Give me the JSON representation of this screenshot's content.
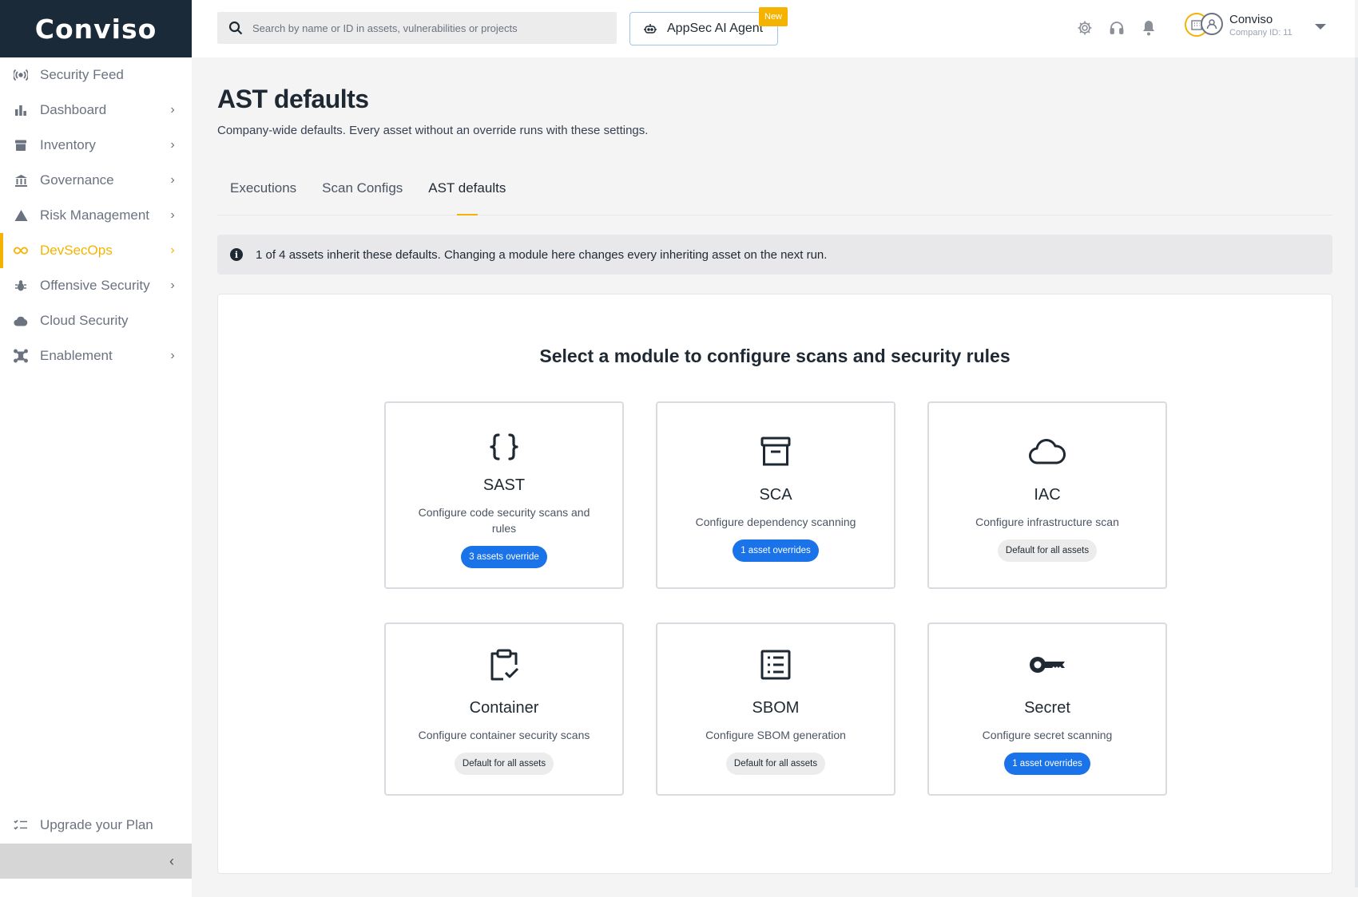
{
  "brand": {
    "logo_text": "Conviso",
    "accent": "#f5b301",
    "sidebar_dark": "#1b2a38",
    "link_blue": "#1a73e8"
  },
  "sidebar": {
    "items": [
      {
        "label": "Security Feed",
        "icon": "radar-icon",
        "chevron": false
      },
      {
        "label": "Dashboard",
        "icon": "bar-chart-icon",
        "chevron": true
      },
      {
        "label": "Inventory",
        "icon": "archive-icon",
        "chevron": true
      },
      {
        "label": "Governance",
        "icon": "bank-icon",
        "chevron": true
      },
      {
        "label": "Risk Management",
        "icon": "warning-icon",
        "chevron": true
      },
      {
        "label": "DevSecOps",
        "icon": "infinity-icon",
        "chevron": true,
        "active": true
      },
      {
        "label": "Offensive Security",
        "icon": "bug-icon",
        "chevron": true
      },
      {
        "label": "Cloud Security",
        "icon": "cloud-icon",
        "chevron": false
      },
      {
        "label": "Enablement",
        "icon": "network-icon",
        "chevron": true
      }
    ],
    "upgrade_label": "Upgrade your Plan"
  },
  "topbar": {
    "search_placeholder": "Search by name or ID in assets, vulnerabilities or projects",
    "ai_button_label": "AppSec AI Agent",
    "new_badge": "New",
    "user_name": "Conviso",
    "company_id": "Company ID: 11"
  },
  "page": {
    "title": "AST defaults",
    "subtitle": "Company-wide defaults. Every asset without an override runs with these settings.",
    "tabs": [
      {
        "label": "Executions"
      },
      {
        "label": "Scan Configs"
      },
      {
        "label": "AST defaults",
        "active": true
      }
    ],
    "info": "1 of 4 assets inherit these defaults. Changing a module here changes every inheriting asset on the next run.",
    "panel_title": "Select a module to configure scans and security rules",
    "modules": [
      {
        "title": "SAST",
        "desc": "Configure code security scans and rules",
        "badge": "3 assets override",
        "badge_type": "blue",
        "icon": "braces-icon"
      },
      {
        "title": "SCA",
        "desc": "Configure dependency scanning",
        "badge": "1 asset overrides",
        "badge_type": "blue",
        "icon": "archive-box-icon"
      },
      {
        "title": "IAC",
        "desc": "Configure infrastructure scan",
        "badge": "Default for all assets",
        "badge_type": "gray",
        "icon": "cloud-outline-icon"
      },
      {
        "title": "Container",
        "desc": "Configure container security scans",
        "badge": "Default for all assets",
        "badge_type": "gray",
        "icon": "clipboard-check-icon"
      },
      {
        "title": "SBOM",
        "desc": "Configure SBOM generation",
        "badge": "Default for all assets",
        "badge_type": "gray",
        "icon": "list-box-icon"
      },
      {
        "title": "Secret",
        "desc": "Configure secret scanning",
        "badge": "1 asset overrides",
        "badge_type": "blue",
        "icon": "key-icon"
      }
    ]
  }
}
